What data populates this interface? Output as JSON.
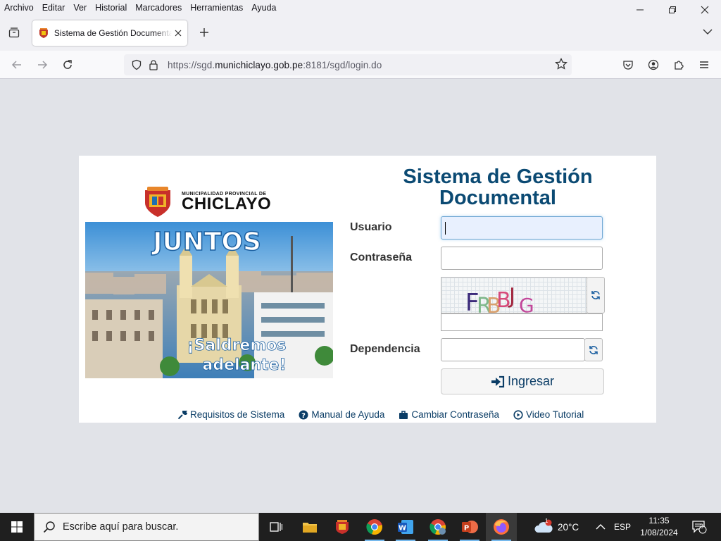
{
  "menu": [
    "Archivo",
    "Editar",
    "Ver",
    "Historial",
    "Marcadores",
    "Herramientas",
    "Ayuda"
  ],
  "tab": {
    "title": "Sistema de Gestión Documental"
  },
  "url": {
    "prefix": "https://sgd.",
    "domain": "munichiclayo.gob.pe",
    "suffix": ":8181/sgd/login.do"
  },
  "logo": {
    "sub": "MUNICIPALIDAD PROVINCIAL DE",
    "main": "CHICLAYO"
  },
  "banner": {
    "line1": "JUNTOS",
    "line2": "¡Saldremos",
    "line3": "adelante!"
  },
  "page": {
    "title_line1": "Sistema de Gestión",
    "title_line2": "Documental"
  },
  "form": {
    "user_label": "Usuario",
    "user_value": "",
    "password_label": "Contraseña",
    "password_value": "",
    "captcha_chars": [
      "F",
      "R",
      "B",
      "B",
      "J",
      "G"
    ],
    "captcha_value": "",
    "dependency_label": "Dependencia",
    "dependency_value": "",
    "submit_label": "Ingresar"
  },
  "links": {
    "requirements": "Requisitos de Sistema",
    "manual": "Manual de Ayuda",
    "change_password": "Cambiar Contraseña",
    "video": "Video Tutorial"
  },
  "taskbar": {
    "search_placeholder": "Escribe aquí para buscar.",
    "weather": "20°C",
    "language": "ESP",
    "time": "11:35",
    "date": "1/08/2024",
    "notifications": "3",
    "weather_badge": "1"
  },
  "colors": {
    "brand_title": "#0b4a73",
    "link": "#0b3d66",
    "field_focus": "#e8f0fe"
  }
}
